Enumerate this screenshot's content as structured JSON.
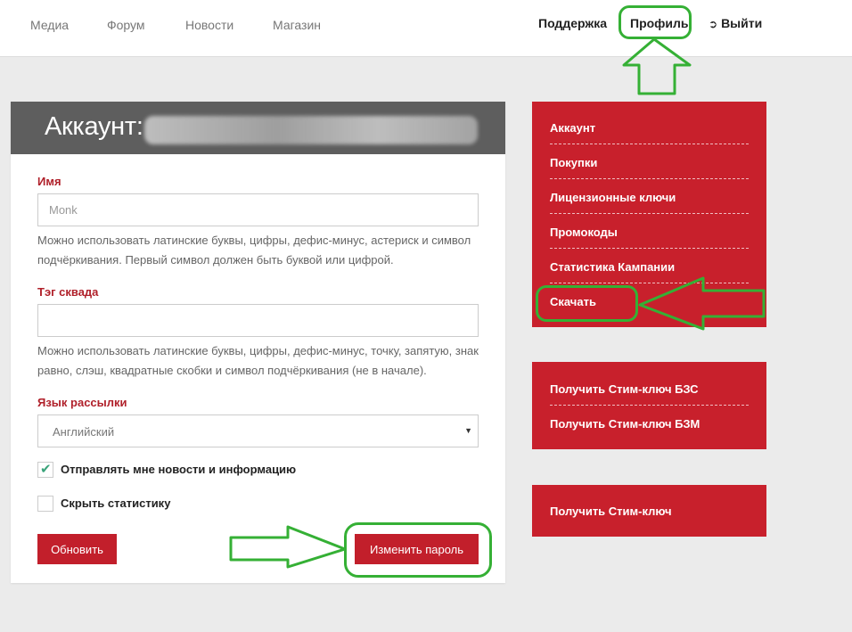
{
  "nav": {
    "left": [
      "Медиа",
      "Форум",
      "Новости",
      "Магазин"
    ],
    "support": "Поддержка",
    "profile": "Профиль",
    "logout": "Выйти"
  },
  "account": {
    "title": "Аккаунт:",
    "name_label": "Имя",
    "name_placeholder": "Monk",
    "name_hint": "Можно использовать латинские буквы, цифры, дефис-минус, астериск и символ подчёркивания. Первый символ должен быть буквой или цифрой.",
    "tag_label": "Тэг сквада",
    "tag_hint": "Можно использовать латинские буквы, цифры, дефис-минус, точку, запятую, знак равно, слэш, квадратные скобки и символ подчёркивания (не в начале).",
    "lang_label": "Язык рассылки",
    "lang_value": "Английский",
    "news_checkbox": "Отправлять мне новости и информацию",
    "news_checked": true,
    "stats_checkbox": "Скрыть статистику",
    "stats_checked": false,
    "update_button": "Обновить",
    "change_password_button": "Изменить пароль"
  },
  "sidebar": {
    "menu": [
      "Аккаунт",
      "Покупки",
      "Лицензионные ключи",
      "Промокоды",
      "Статистика Кампании",
      "Скачать"
    ],
    "keys": [
      "Получить Стим-ключ БЗС",
      "Получить Стим-ключ БЗМ"
    ],
    "single_key": "Получить Стим-ключ"
  },
  "colors": {
    "accent_red": "#c8202c",
    "header_gray": "#5e5e5e",
    "annotation_green": "#35b035"
  }
}
